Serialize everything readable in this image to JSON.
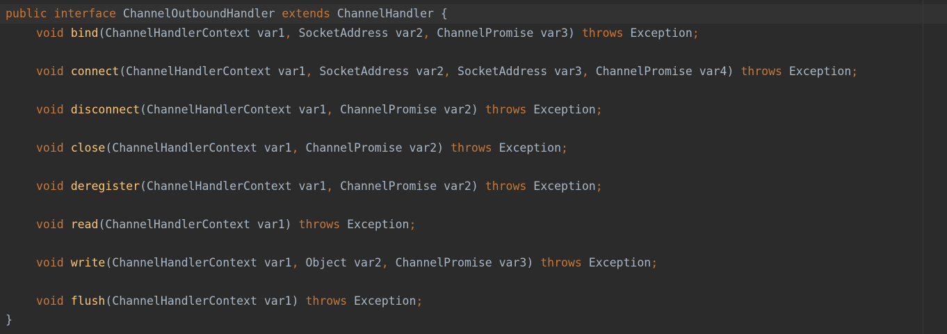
{
  "header": {
    "mod_public": "public",
    "kw_interface": "interface",
    "name": "ChannelOutboundHandler",
    "kw_extends": "extends",
    "parent": "ChannelHandler",
    "open_brace": "{"
  },
  "methods": [
    {
      "ret": "void",
      "name": "bind",
      "params": [
        {
          "text": "ChannelHandlerContext var1"
        },
        {
          "text": "SocketAddress var2"
        },
        {
          "text": "ChannelPromise var3"
        }
      ],
      "throws": "throws",
      "exception": "Exception"
    },
    {
      "ret": "void",
      "name": "connect",
      "params": [
        {
          "text": "ChannelHandlerContext var1"
        },
        {
          "text": "SocketAddress var2"
        },
        {
          "text": "SocketAddress var3"
        },
        {
          "text": "ChannelPromise var4"
        }
      ],
      "throws": "throws",
      "exception": "Exception"
    },
    {
      "ret": "void",
      "name": "disconnect",
      "params": [
        {
          "text": "ChannelHandlerContext var1"
        },
        {
          "text": "ChannelPromise var2"
        }
      ],
      "throws": "throws",
      "exception": "Exception"
    },
    {
      "ret": "void",
      "name": "close",
      "params": [
        {
          "text": "ChannelHandlerContext var1"
        },
        {
          "text": "ChannelPromise var2"
        }
      ],
      "throws": "throws",
      "exception": "Exception"
    },
    {
      "ret": "void",
      "name": "deregister",
      "params": [
        {
          "text": "ChannelHandlerContext var1"
        },
        {
          "text": "ChannelPromise var2"
        }
      ],
      "throws": "throws",
      "exception": "Exception"
    },
    {
      "ret": "void",
      "name": "read",
      "params": [
        {
          "text": "ChannelHandlerContext var1"
        }
      ],
      "throws": "throws",
      "exception": "Exception"
    },
    {
      "ret": "void",
      "name": "write",
      "params": [
        {
          "text": "ChannelHandlerContext var1"
        },
        {
          "text": "Object var2"
        },
        {
          "text": "ChannelPromise var3"
        }
      ],
      "throws": "throws",
      "exception": "Exception"
    },
    {
      "ret": "void",
      "name": "flush",
      "params": [
        {
          "text": "ChannelHandlerContext var1"
        }
      ],
      "throws": "throws",
      "exception": "Exception"
    }
  ],
  "closing_brace": "}",
  "syntax": {
    "comma": ",",
    "semicolon": ";",
    "paren_open": "(",
    "paren_close": ")"
  },
  "colors": {
    "background": "#2b2b2b",
    "current_line": "#323232",
    "keyword": "#cc7832",
    "method_name": "#ffc66d",
    "identifier": "#a9b7c6"
  }
}
